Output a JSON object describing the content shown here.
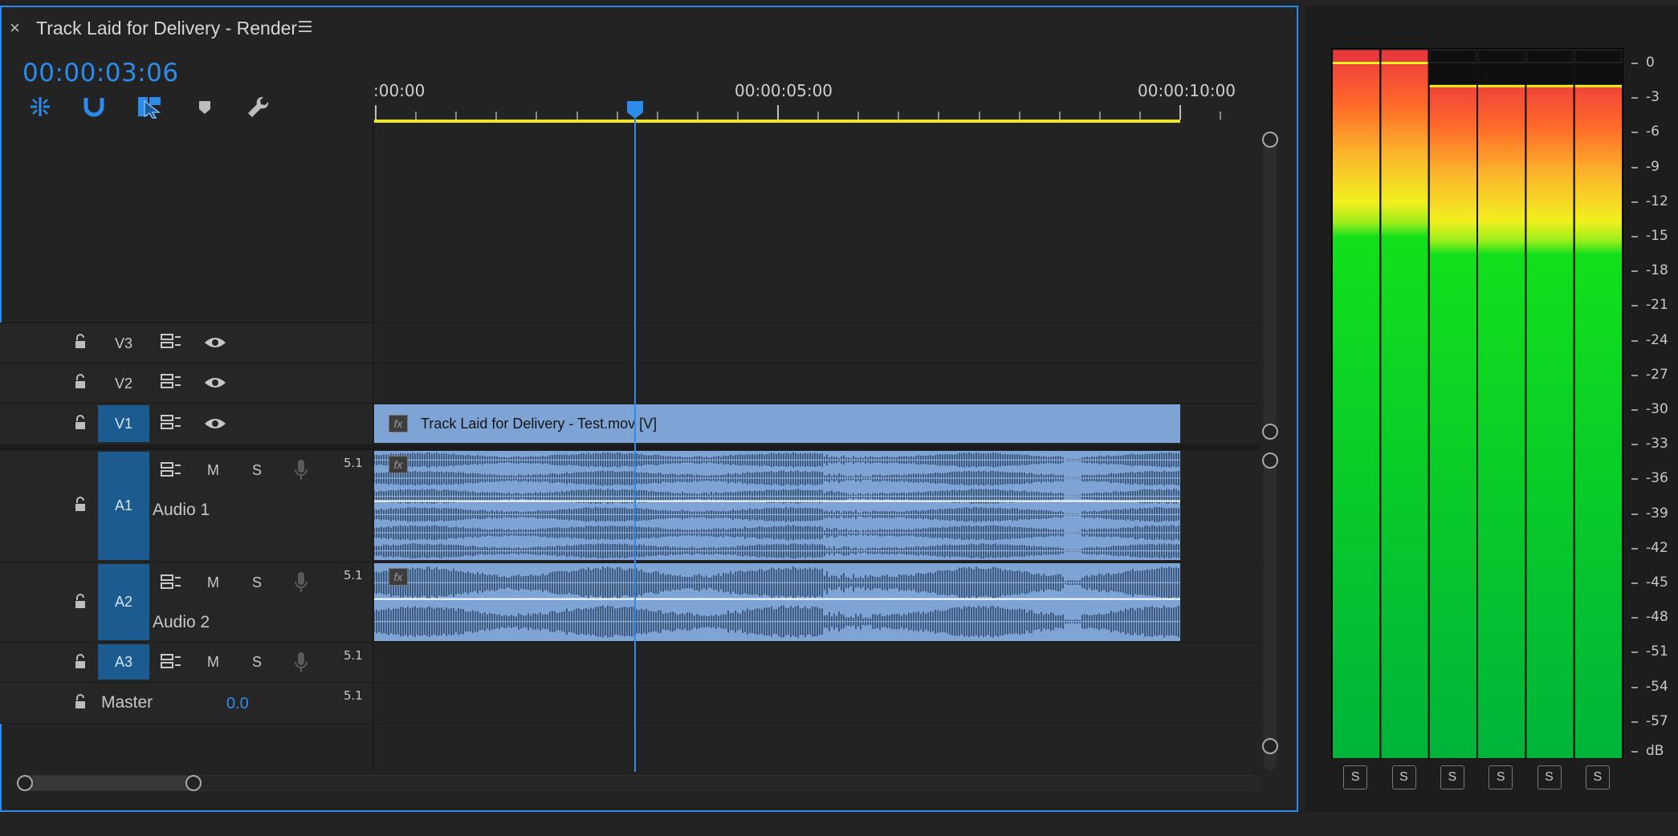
{
  "panel": {
    "title": "Track Laid for Delivery - Render",
    "close_glyph": "×",
    "menu_glyph": "≡"
  },
  "timecode": "00:00:03:06",
  "tools": [
    "snap-icon",
    "magnet-icon",
    "linked-selection-icon",
    "add-marker-icon",
    "wrench-icon"
  ],
  "ruler": {
    "labels": [
      ":00:00",
      "00:00:05:00",
      "00:00:10:00"
    ]
  },
  "tracks": {
    "video": [
      {
        "id": "V3",
        "active": false
      },
      {
        "id": "V2",
        "active": false
      },
      {
        "id": "V1",
        "active": true
      }
    ],
    "audio": [
      {
        "id": "A1",
        "name": "Audio 1",
        "channels": "5.1",
        "mute": "M",
        "solo": "S"
      },
      {
        "id": "A2",
        "name": "Audio 2",
        "channels": "5.1",
        "mute": "M",
        "solo": "S"
      },
      {
        "id": "A3",
        "name": "",
        "channels": "5.1",
        "mute": "M",
        "solo": "S"
      }
    ],
    "master": {
      "label": "Master",
      "value": "0.0",
      "channels": "5.1"
    }
  },
  "clips": {
    "video_clip_label": "Track Laid for Delivery - Test.mov [V]",
    "fx_label": "fx"
  },
  "meter": {
    "scale": [
      "0",
      "-3",
      "-6",
      "-9",
      "-12",
      "-15",
      "-18",
      "-21",
      "-24",
      "-27",
      "-30",
      "-33",
      "-36",
      "-39",
      "-42",
      "-45",
      "-48",
      "-51",
      "-54",
      "-57",
      "dB"
    ],
    "solo_labels": [
      "S",
      "S",
      "S",
      "S",
      "S",
      "S"
    ],
    "channel_peaks_db": [
      0,
      0,
      -2,
      -2,
      -2,
      -2
    ],
    "channel_clip": [
      true,
      true,
      false,
      false,
      false,
      false
    ]
  },
  "colors": {
    "accent": "#2d8ceb",
    "clip": "#7ea4d6",
    "active_track": "#1c5b8f",
    "work_area": "#f0e619"
  }
}
